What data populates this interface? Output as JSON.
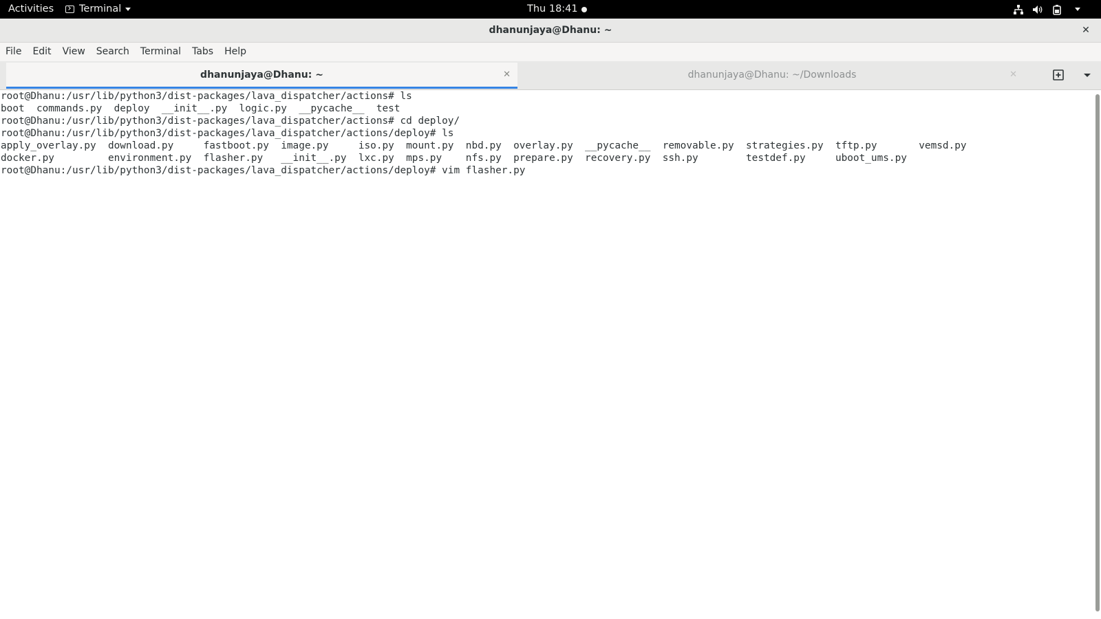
{
  "topbar": {
    "activities_label": "Activities",
    "app_menu_label": "Terminal",
    "clock": "Thu 18:41"
  },
  "window": {
    "title": "dhanunjaya@Dhanu: ~",
    "close_glyph": "✕"
  },
  "menubar": {
    "items": [
      "File",
      "Edit",
      "View",
      "Search",
      "Terminal",
      "Tabs",
      "Help"
    ]
  },
  "tabs": [
    {
      "label": "dhanunjaya@Dhanu: ~",
      "active": true,
      "close_glyph": "✕"
    },
    {
      "label": "dhanunjaya@Dhanu: ~/Downloads",
      "active": false,
      "close_glyph": "✕"
    }
  ],
  "terminal": {
    "lines": [
      "root@Dhanu:/usr/lib/python3/dist-packages/lava_dispatcher/actions# ls",
      "boot  commands.py  deploy  __init__.py  logic.py  __pycache__  test",
      "root@Dhanu:/usr/lib/python3/dist-packages/lava_dispatcher/actions# cd deploy/",
      "root@Dhanu:/usr/lib/python3/dist-packages/lava_dispatcher/actions/deploy# ls",
      "apply_overlay.py  download.py     fastboot.py  image.py     iso.py  mount.py  nbd.py  overlay.py  __pycache__  removable.py  strategies.py  tftp.py       vemsd.py",
      "docker.py         environment.py  flasher.py   __init__.py  lxc.py  mps.py    nfs.py  prepare.py  recovery.py  ssh.py        testdef.py     uboot_ums.py",
      "root@Dhanu:/usr/lib/python3/dist-packages/lava_dispatcher/actions/deploy# vim flasher.py"
    ]
  },
  "icons": {
    "app_menu": "terminal-icon",
    "network": "network-icon",
    "volume": "volume-icon",
    "power": "power-icon",
    "new_tab": "new-tab-icon",
    "tabs_menu": "chevron-down-icon"
  },
  "colors": {
    "topbar_bg": "#000000",
    "tab_accent": "#3584e4",
    "terminal_bg": "#ffffff",
    "terminal_fg": "#2e3436"
  }
}
